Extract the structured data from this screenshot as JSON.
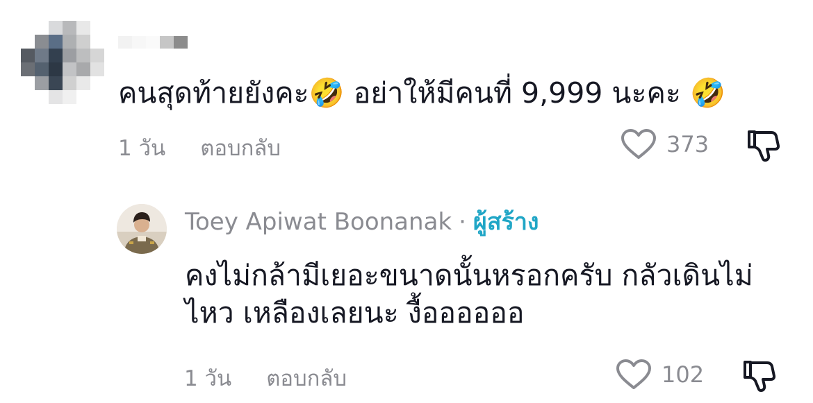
{
  "comment": {
    "text": "คนสุดท้ายยังคะ🤣 อย่าให้มีคนที่ 9,999 นะคะ 🤣",
    "time": "1 วัน",
    "reply_label": "ตอบกลับ",
    "likes": "373"
  },
  "reply": {
    "author": "Toey Apiwat Boonanak",
    "separator": "·",
    "creator_tag": "ผู้สร้าง",
    "text_line1": "คงไม่กล้ามีเยอะขนาดนั้นหรอกครับ กลัวเดินไม่",
    "text_line2": "ไหว เหลืองเลยนะ งื้ออออออ",
    "time": "1 วัน",
    "reply_label": "ตอบกลับ",
    "likes": "102"
  },
  "colors": {
    "text": "#161823",
    "muted": "#8a8b91",
    "creator_accent": "#20a6c6"
  },
  "icons": {
    "like": "heart-outline-icon",
    "dislike": "thumbs-down-outline-icon"
  }
}
